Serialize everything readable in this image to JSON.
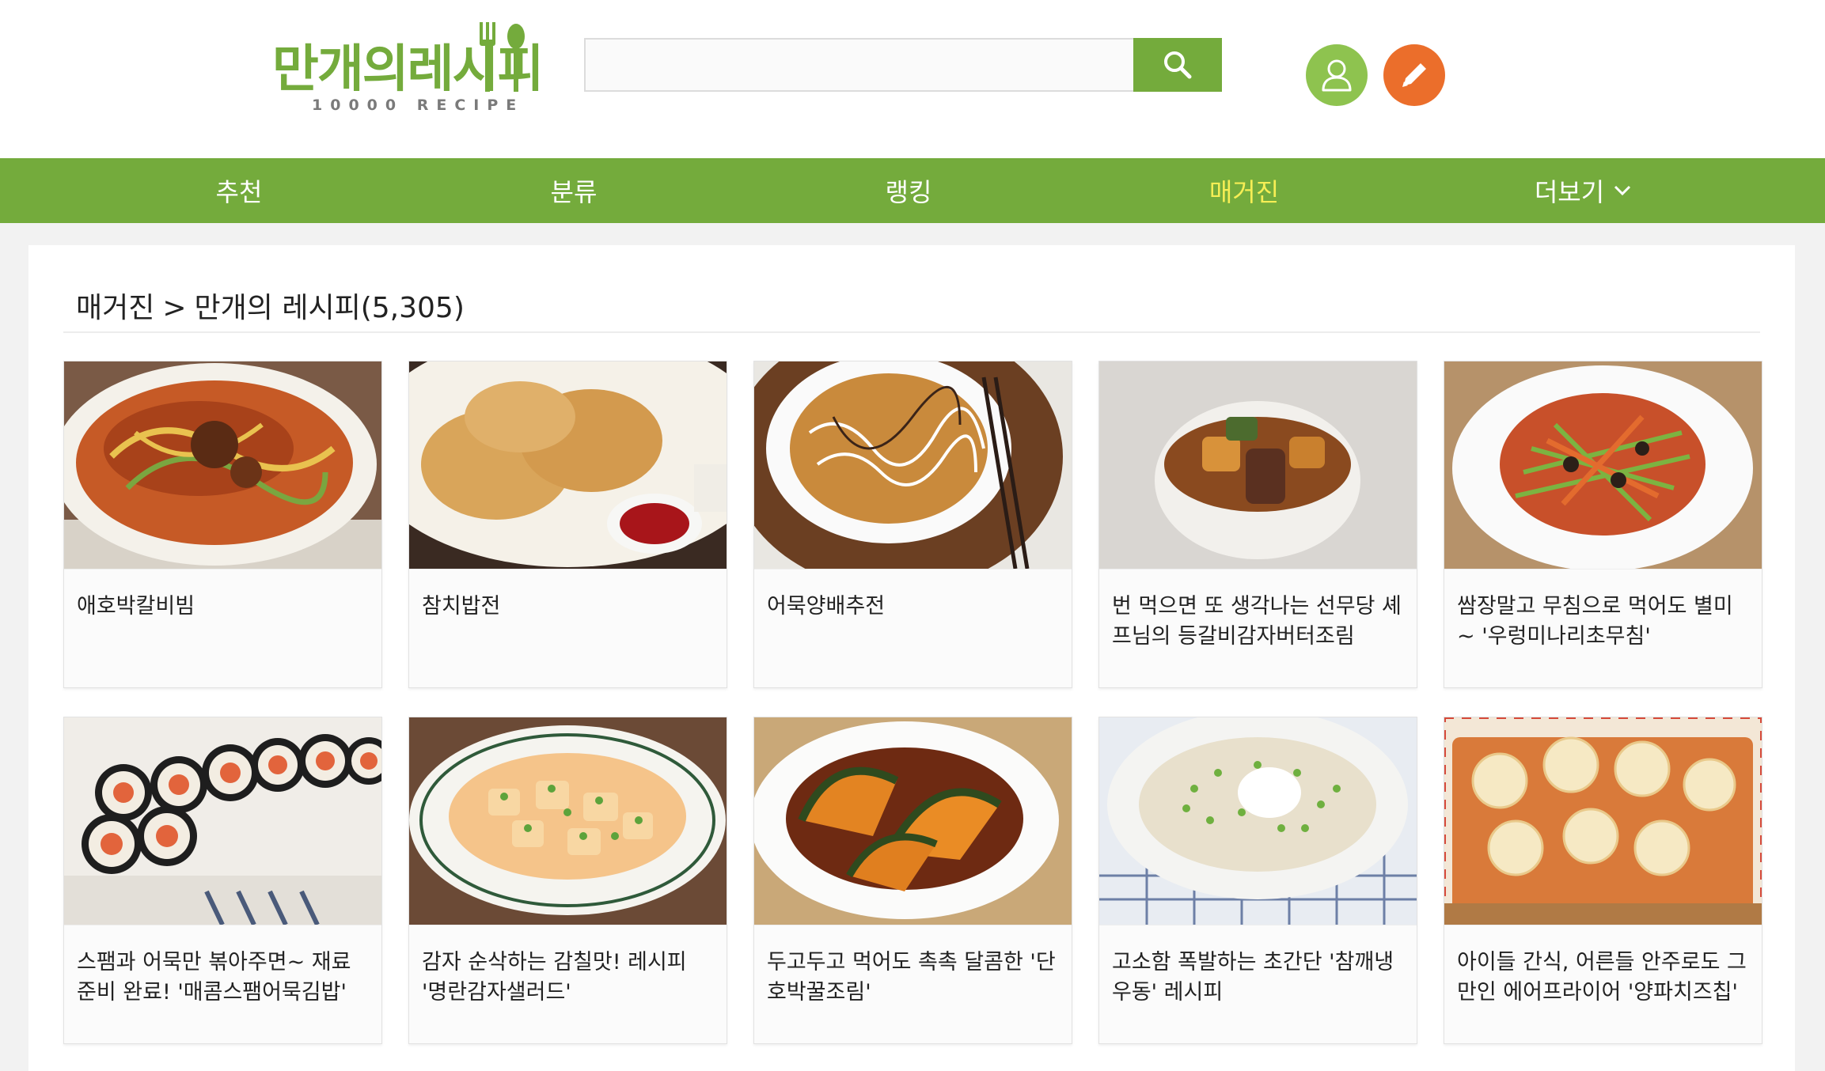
{
  "logo": {
    "main": "만개의레시피",
    "sub": "10000 RECIPE",
    "color": "#74ab3c"
  },
  "search": {
    "value": "",
    "placeholder": "",
    "icon": "search-icon"
  },
  "header_icons": {
    "user": "user-icon",
    "write": "pencil-icon"
  },
  "nav": {
    "items": [
      {
        "label": "추천"
      },
      {
        "label": "분류"
      },
      {
        "label": "랭킹"
      },
      {
        "label": "매거진",
        "active": true
      },
      {
        "label": "더보기"
      }
    ],
    "active_color": "#f6ee55",
    "bg_color": "#74ab3c"
  },
  "breadcrumb": {
    "section": "매거진",
    "separator": ">",
    "current": "만개의 레시피(5,305)"
  },
  "recipes": [
    {
      "title": "애호박칼비빔"
    },
    {
      "title": "참치밥전"
    },
    {
      "title": "어묵양배추전"
    },
    {
      "title": "번 먹으면 또 생각나는 선무당 셰프님의 등갈비감자버터조림"
    },
    {
      "title": "쌈장말고 무침으로 먹어도 별미~ '우렁미나리초무침'"
    },
    {
      "title": "스팸과 어묵만 볶아주면~ 재료준비 완료! '매콤스팸어묵김밥'"
    },
    {
      "title": "감자 순삭하는 감칠맛! 레시피 '명란감자샐러드'"
    },
    {
      "title": "두고두고 먹어도 촉촉 달콤한 '단호박꿀조림'"
    },
    {
      "title": "고소함 폭발하는 초간단 '참깨냉우동' 레시피"
    },
    {
      "title": "아이들 간식, 어른들 안주로도 그만인 에어프라이어 '양파치즈칩'"
    }
  ]
}
